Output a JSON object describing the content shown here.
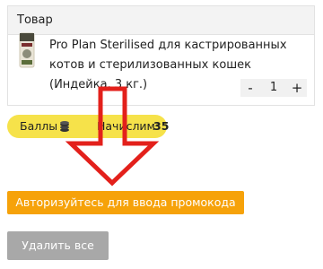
{
  "cart": {
    "header": "Товар",
    "item": {
      "name": "Pro Plan Sterilised для кастрированных котов и стерилизованных кошек (Индейка, 3 кг.)",
      "quantity": "1",
      "decrease_label": "-",
      "increase_label": "+",
      "thumbnail_icon": "pet-food-bag-icon"
    }
  },
  "points": {
    "label": "Баллы",
    "icon": "coins-icon",
    "accrued_label": "Начислим:",
    "accrued_value": "35",
    "bar_color": "#f6e24a"
  },
  "annotation": {
    "icon": "red-down-arrow-icon",
    "color": "#e3201b"
  },
  "actions": {
    "promo_button_label": "Авторизуйтесь для ввода промокода",
    "promo_button_color": "#f6a20a",
    "delete_all_label": "Удалить все",
    "delete_all_color": "#a8a8a8"
  }
}
